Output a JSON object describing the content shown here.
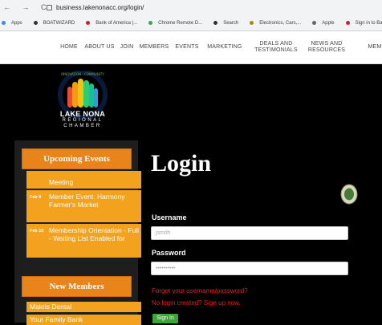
{
  "browser": {
    "nav_arrows": "← → C",
    "url": "business.lakenonacc.org/login/",
    "bookmarks": [
      {
        "label": "Apps",
        "color": "#4285f4"
      },
      {
        "label": "BOATWIZARD",
        "color": "#333333"
      },
      {
        "label": "Bank of America |...",
        "color": "#d71e28"
      },
      {
        "label": "Chrome Remote D...",
        "color": "#34a853"
      },
      {
        "label": "Search",
        "color": "#333333"
      },
      {
        "label": "Electronics, Cars,...",
        "color": "#b8860b"
      },
      {
        "label": "Apple",
        "color": "#666666"
      },
      {
        "label": "Sign in to Bank o",
        "color": "#d71e28"
      }
    ]
  },
  "site_nav": {
    "items": [
      "HOME",
      "ABOUT US",
      "JOIN",
      "MEMBERS",
      "EVENTS",
      "MARKETING",
      "DEALS AND\nTESTIMONIALS",
      "NEWS AND\nRESOURCES",
      "MEM"
    ]
  },
  "logo": {
    "arc_text": "INNOVATION · COMMUNITY",
    "main_lines": [
      "LAKE NONA"
    ],
    "sub_lines": [
      "REGIONAL",
      "CHAMBER"
    ]
  },
  "sidebar": {
    "upcoming_title": "Upcoming Events",
    "events": [
      {
        "date": "",
        "title": "Meeting"
      },
      {
        "date": "Feb 9",
        "title": "Member Event: Harmony Farmer's Market"
      },
      {
        "date": "Feb 10",
        "title": "Membership Orientation - Full - Waiting List Enabled for"
      }
    ],
    "new_members_title": "New Members",
    "members": [
      "Makris Dental",
      "Your Family Bank"
    ]
  },
  "login": {
    "title": "Login",
    "username_label": "Username",
    "username_value": "jsmith",
    "password_label": "Password",
    "password_value": "••••••••••",
    "forgot_link": "Forgot your username/password?",
    "signup_link": "No login created? Sign up now.",
    "signin_button": "Sign In"
  },
  "colors": {
    "accent_orange": "#e8841a",
    "event_orange": "#f2a21c",
    "link_red": "#e02020",
    "signin_green": "#3aa635"
  }
}
